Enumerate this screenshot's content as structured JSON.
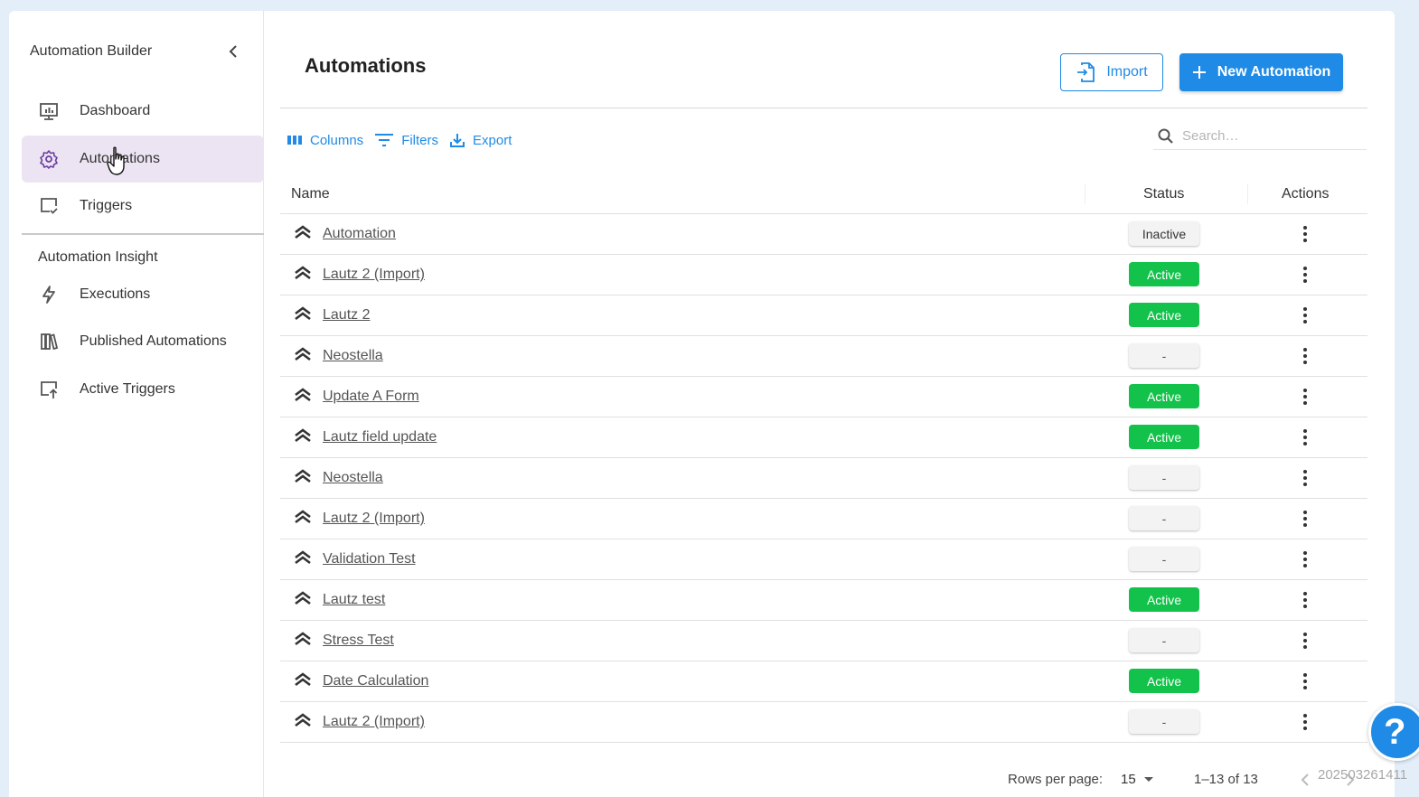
{
  "sidebar": {
    "title": "Automation Builder",
    "section_label": "Automation Insight",
    "items": [
      {
        "label": "Dashboard"
      },
      {
        "label": "Automations"
      },
      {
        "label": "Triggers"
      },
      {
        "label": "Executions"
      },
      {
        "label": "Published Automations"
      },
      {
        "label": "Active Triggers"
      }
    ]
  },
  "header": {
    "title": "Automations",
    "import_label": "Import",
    "new_label": "New Automation"
  },
  "toolbar": {
    "columns_label": "Columns",
    "filters_label": "Filters",
    "export_label": "Export",
    "search_placeholder": "Search…"
  },
  "table": {
    "columns": {
      "name": "Name",
      "status": "Status",
      "actions": "Actions"
    },
    "rows": [
      {
        "name": "Automation",
        "status": "Inactive"
      },
      {
        "name": "Lautz 2 (Import)",
        "status": "Active"
      },
      {
        "name": "Lautz 2",
        "status": "Active"
      },
      {
        "name": "Neostella",
        "status": "-"
      },
      {
        "name": "Update A Form",
        "status": "Active"
      },
      {
        "name": "Lautz field update",
        "status": "Active"
      },
      {
        "name": "Neostella",
        "status": "-"
      },
      {
        "name": "Lautz 2 (Import)",
        "status": "-"
      },
      {
        "name": "Validation Test",
        "status": "-"
      },
      {
        "name": "Lautz test",
        "status": "Active"
      },
      {
        "name": "Stress Test",
        "status": "-"
      },
      {
        "name": "Date Calculation",
        "status": "Active"
      },
      {
        "name": "Lautz 2 (Import)",
        "status": "-"
      }
    ]
  },
  "pagination": {
    "rows_per_page_label": "Rows per page:",
    "rows_per_page_value": "15",
    "range": "1–13 of 13"
  },
  "help_label": "?",
  "stamp": "202503261411",
  "colors": {
    "accent": "#1f8be6",
    "active_badge": "#13c24b",
    "active_nav": "#ece4f3",
    "nav_icon_active": "#6b3fa0"
  },
  "icons": {
    "dashboard": "monitor-icon",
    "automations": "gear-icon",
    "triggers": "checked-screen-icon",
    "executions": "bolt-icon",
    "published": "library-icon",
    "active_triggers": "screen-upload-icon",
    "row": "double-chevron-up-icon"
  }
}
